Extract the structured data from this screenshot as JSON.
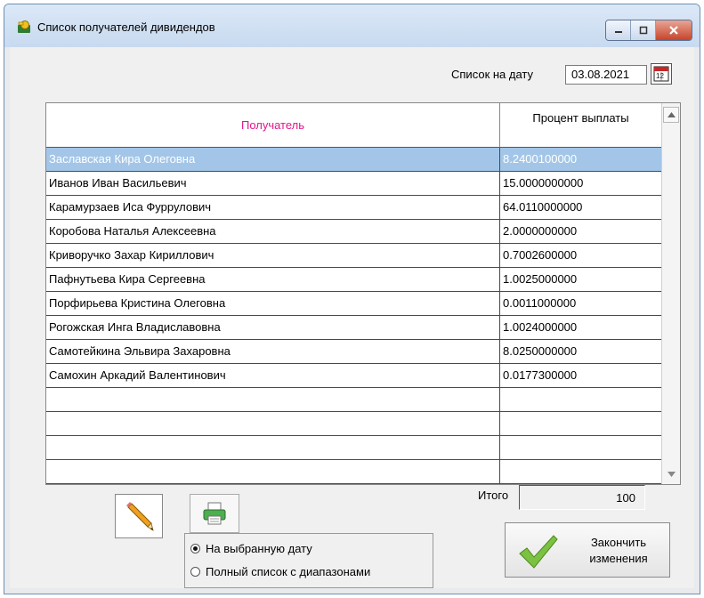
{
  "window": {
    "title": "Список получателей дивидендов",
    "controls": [
      "minimize-icon",
      "maximize-icon",
      "close-icon"
    ]
  },
  "date_filter": {
    "label": "Список на дату",
    "value": "03.08.2021",
    "calendar_icon": "calendar-icon"
  },
  "grid": {
    "columns": [
      "Получатель",
      "Процент выплаты"
    ],
    "rows": [
      {
        "name": "Заславская Кира Олеговна",
        "percent": "8.2400100000",
        "selected": true
      },
      {
        "name": "Иванов Иван Васильевич",
        "percent": "15.0000000000"
      },
      {
        "name": "Карамурзаев Иса Фуррулович",
        "percent": "64.0110000000"
      },
      {
        "name": "Коробова Наталья Алексеевна",
        "percent": "2.0000000000"
      },
      {
        "name": "Криворучко Захар Кириллович",
        "percent": "0.7002600000"
      },
      {
        "name": "Пафнутьева Кира Сергеевна",
        "percent": "1.0025000000"
      },
      {
        "name": "Порфирьева Кристина Олеговна",
        "percent": "0.0011000000"
      },
      {
        "name": "Рогожская Инга Владиславовна",
        "percent": "1.0024000000"
      },
      {
        "name": "Самотейкина Эльвира Захаровна",
        "percent": "8.0250000000"
      },
      {
        "name": "Самохин Аркадий Валентинович",
        "percent": "0.0177300000"
      },
      {
        "name": "",
        "percent": ""
      },
      {
        "name": "",
        "percent": ""
      },
      {
        "name": "",
        "percent": ""
      },
      {
        "name": "",
        "percent": ""
      }
    ]
  },
  "total": {
    "label": "Итого",
    "value": "100"
  },
  "toolbar": {
    "edit_icon": "pencil-icon",
    "print_icon": "printer-icon"
  },
  "mode": {
    "options": [
      "На выбранную дату",
      "Полный список с диапазонами"
    ],
    "selected": "На выбранную дату"
  },
  "finish_button": {
    "line1": "Закончить",
    "line2": "изменения",
    "icon": "checkmark-icon"
  },
  "colors": {
    "header_highlight": "#e0168f",
    "selection": "#a3c6e8",
    "title_bar": "#dbe8f7",
    "close_button": "#c7442a"
  }
}
